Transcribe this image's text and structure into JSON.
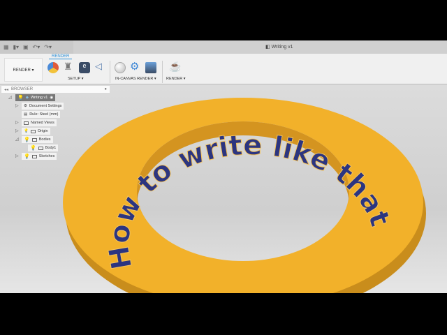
{
  "window": {
    "title": "Writing v1"
  },
  "ribbon": {
    "workspace": "RENDER ▾",
    "active_tab": "RENDER",
    "groups": [
      {
        "label": "SETUP ▾"
      },
      {
        "label": "IN-CANVAS RENDER ▾"
      },
      {
        "label": "RENDER ▾"
      }
    ]
  },
  "browser": {
    "title": "BROWSER",
    "items": [
      {
        "label": "Writing v1"
      },
      {
        "label": "Document Settings"
      },
      {
        "label": "Rule: Steel (mm)"
      },
      {
        "label": "Named Views"
      },
      {
        "label": "Origin"
      },
      {
        "label": "Bodies"
      },
      {
        "label": "Body1"
      },
      {
        "label": "Sketches"
      }
    ]
  },
  "model": {
    "text": "How to write like that.",
    "body_color": "#f2b12a",
    "text_color": "#2c3580"
  }
}
